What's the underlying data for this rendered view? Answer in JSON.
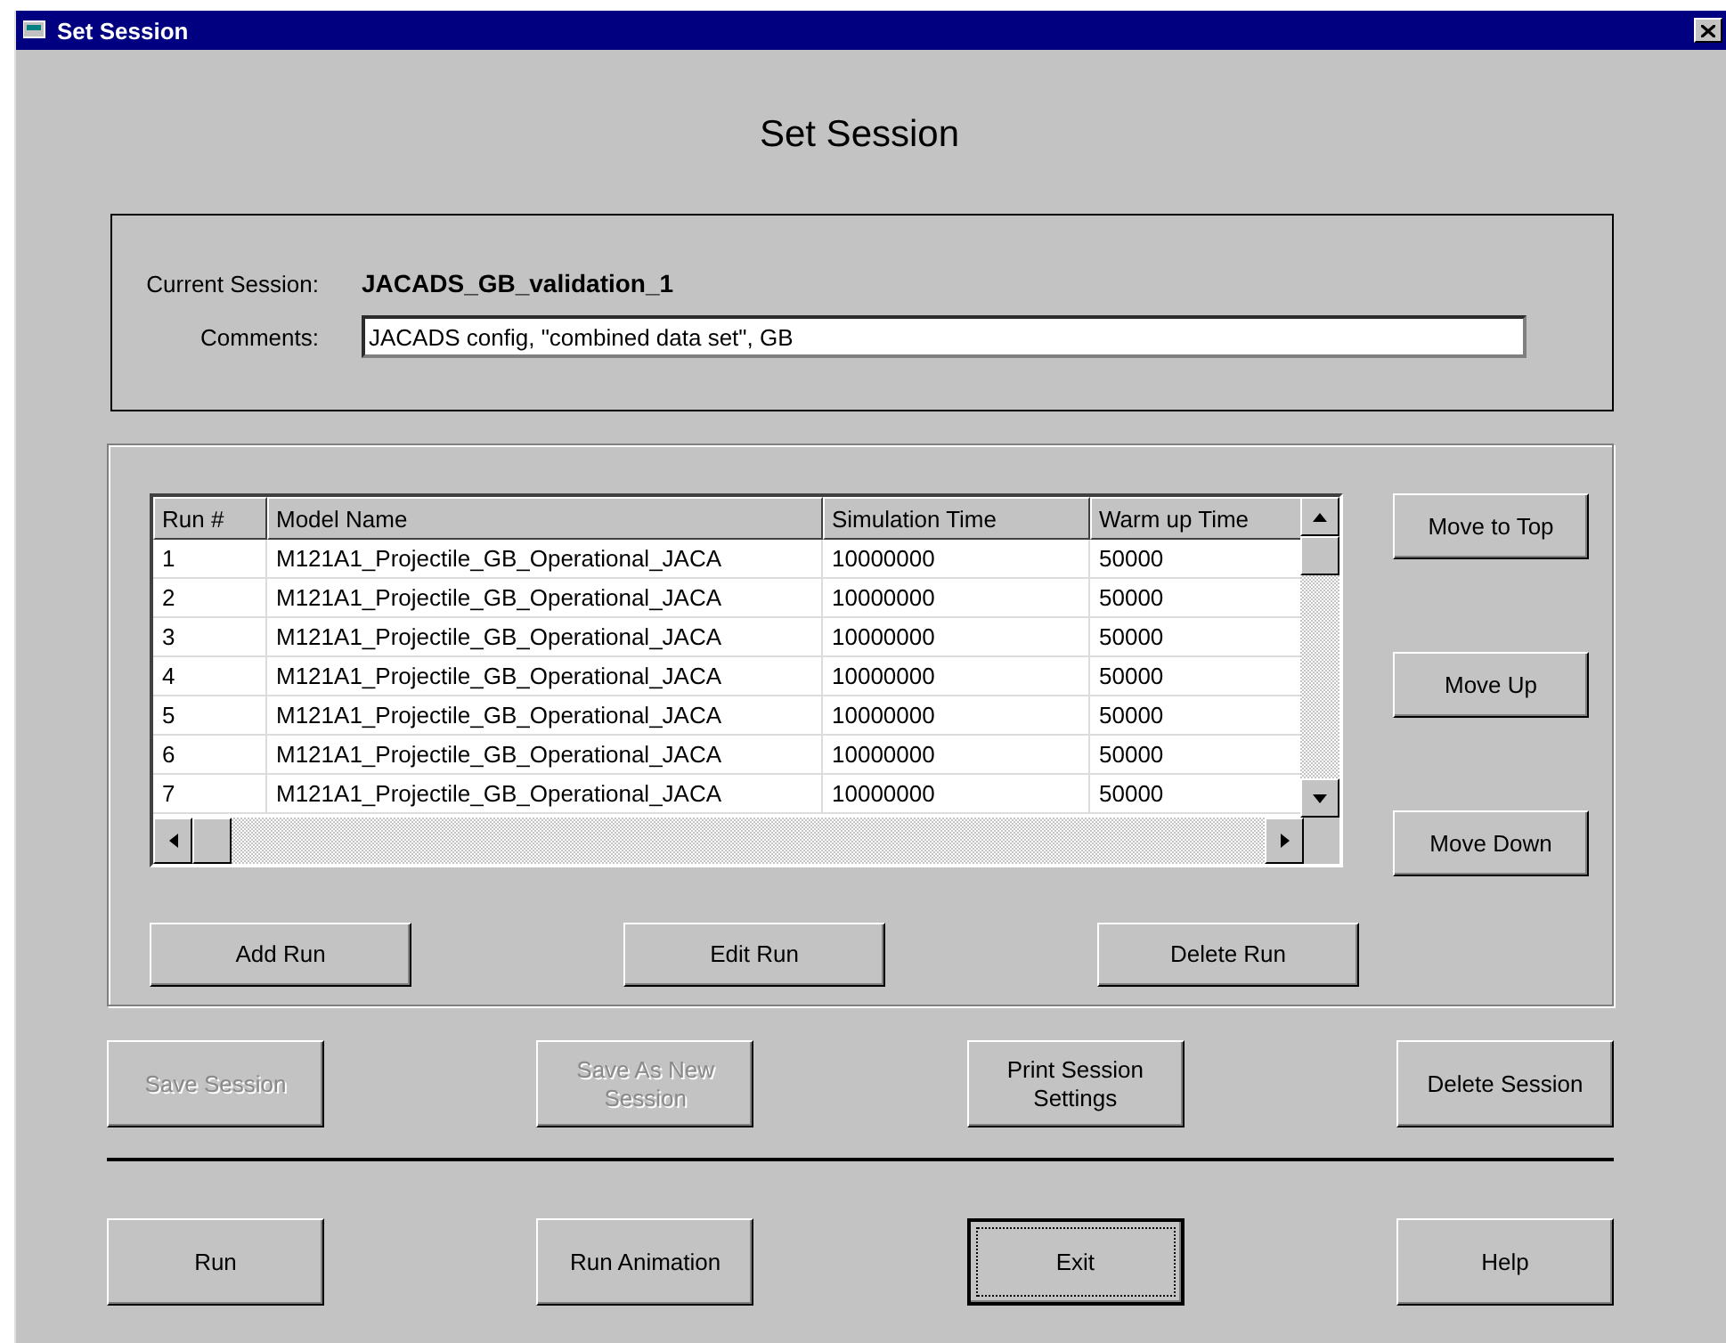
{
  "window": {
    "title": "Set Session"
  },
  "heading": "Set Session",
  "session": {
    "current_label": "Current Session:",
    "current_value": "JACADS_GB_validation_1",
    "comments_label": "Comments:",
    "comments_value": "JACADS config, \"combined data set\", GB"
  },
  "table": {
    "columns": [
      "Run #",
      "Model Name",
      "Simulation Time",
      "Warm up Time"
    ],
    "rows": [
      [
        "1",
        "M121A1_Projectile_GB_Operational_JACA",
        "10000000",
        "50000"
      ],
      [
        "2",
        "M121A1_Projectile_GB_Operational_JACA",
        "10000000",
        "50000"
      ],
      [
        "3",
        "M121A1_Projectile_GB_Operational_JACA",
        "10000000",
        "50000"
      ],
      [
        "4",
        "M121A1_Projectile_GB_Operational_JACA",
        "10000000",
        "50000"
      ],
      [
        "5",
        "M121A1_Projectile_GB_Operational_JACA",
        "10000000",
        "50000"
      ],
      [
        "6",
        "M121A1_Projectile_GB_Operational_JACA",
        "10000000",
        "50000"
      ],
      [
        "7",
        "M121A1_Projectile_GB_Operational_JACA",
        "10000000",
        "50000"
      ]
    ]
  },
  "order_buttons": [
    {
      "label": "Move to Top",
      "disabled": false
    },
    {
      "label": "Move Up",
      "disabled": false
    },
    {
      "label": "Move Down",
      "disabled": false
    }
  ],
  "run_buttons": [
    {
      "label": "Add Run",
      "disabled": false
    },
    {
      "label": "Edit Run",
      "disabled": false
    },
    {
      "label": "Delete Run",
      "disabled": false
    }
  ],
  "session_buttons": [
    {
      "label": "Save Session",
      "disabled": true,
      "focused": false
    },
    {
      "label": "Save As New Session",
      "disabled": true,
      "focused": false
    },
    {
      "label": "Print Session Settings",
      "disabled": false,
      "focused": false
    },
    {
      "label": "Delete Session",
      "disabled": false,
      "focused": false
    }
  ],
  "action_buttons": [
    {
      "label": "Run",
      "disabled": false,
      "focused": false
    },
    {
      "label": "Run Animation",
      "disabled": false,
      "focused": false
    },
    {
      "label": "Exit",
      "disabled": false,
      "focused": true
    },
    {
      "label": "Help",
      "disabled": false,
      "focused": false
    }
  ]
}
